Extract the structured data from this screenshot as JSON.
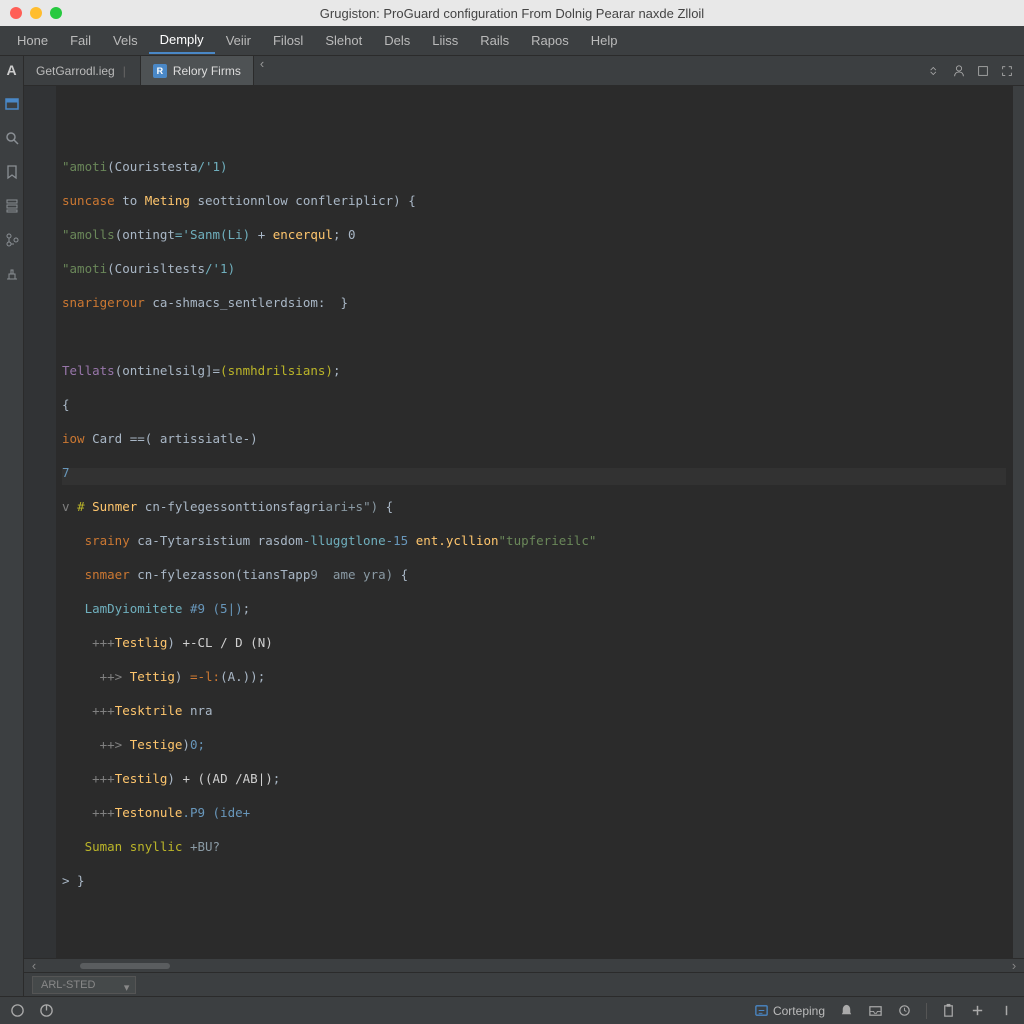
{
  "window": {
    "title": "Grugiston: ProGuard configuration From Dolnig Pearar naxde Zlloil"
  },
  "menu": [
    "Hone",
    "Fail",
    "Vels",
    "Demply",
    "Veiir",
    "Filosl",
    "Slehot",
    "Dels",
    "Liiss",
    "Rails",
    "Rapos",
    "Help"
  ],
  "menu_active_index": 3,
  "tabs": [
    {
      "label": "GetGarrodl.ieg",
      "active": false
    },
    {
      "icon": "R",
      "label": "Relory Firms",
      "active": true
    }
  ],
  "code_lines": {
    "l1": {
      "a": "\"amoti",
      "b": "(Couristesta",
      "c": "/'1)"
    },
    "l2": {
      "a": "suncase",
      "b": " to ",
      "c": "Meting",
      "d": " seottionnlow confleriplicr) ",
      "e": "{"
    },
    "l3": {
      "a": "\"amolls",
      "b": "(ontingt",
      "c": "='Sanm(Li)",
      "d": " + ",
      "e": "encerqul",
      "f": "; 0"
    },
    "l4": {
      "a": "\"amoti",
      "b": "(Courisltests",
      "c": "/'1)"
    },
    "l5": {
      "a": "snarigerour",
      "b": " ca-shmacs_sentlerdsiom:",
      "c": "  }"
    },
    "l6": "",
    "l7": {
      "a": "Tellats",
      "b": "(ontinelsilg]=",
      "c": "(snmhdrilsians)",
      "d": ";"
    },
    "l8": {
      "a": "{"
    },
    "l9": {
      "a": "iow",
      "b": " Card ",
      "c": "==",
      "d": "( artissiatle-)"
    },
    "l10": {
      "a": "7"
    },
    "l11": {
      "a": "v ",
      "b": "# ",
      "c": "Sunmer",
      "d": " cn-fylegessonttionsfagri",
      "e": "ari+s\")",
      "f": " {"
    },
    "l12": {
      "a": "   srainy",
      "b": " ca-Tytarsistium rasdom",
      "c": "-lluggtlone",
      "d": "-15 ",
      "e": "ent.ycllion",
      "f": "\"tupferieilc\""
    },
    "l13": {
      "a": "   snmaer",
      "b": " cn-fylezasson(tiansTapp",
      "c": "9  ame yra)",
      "d": " {"
    },
    "l14": {
      "a": "   LamDyiomitete ",
      "b": "#9 (5|)",
      "c": ";"
    },
    "l15": {
      "a": "    +++",
      "b": "Testlig",
      "c": ") ",
      "d": "+-CL / D (N)"
    },
    "l16": {
      "a": "     ++> ",
      "b": "Tettig",
      "c": ") ",
      "d": "=-l:",
      "e": "(A.));"
    },
    "l17": {
      "a": "    +++",
      "b": "Tesktrile",
      "c": " nra"
    },
    "l18": {
      "a": "     ++> ",
      "b": "Testige",
      "c": ")",
      "d": "0;"
    },
    "l19": {
      "a": "    +++",
      "b": "Testilg",
      "c": ") ",
      "d": "+ ((AD /AB|)",
      "e": ";"
    },
    "l20": {
      "a": "    +++",
      "b": "Testonule",
      "c": ".P9 (ide+"
    },
    "l21": {
      "a": "   Suman snyllic",
      "b": " +BU?"
    },
    "l22": {
      "a": "> }"
    }
  },
  "breadcrumb": {
    "select": "ARL-STED"
  },
  "status": {
    "corteping": "Corteping"
  }
}
